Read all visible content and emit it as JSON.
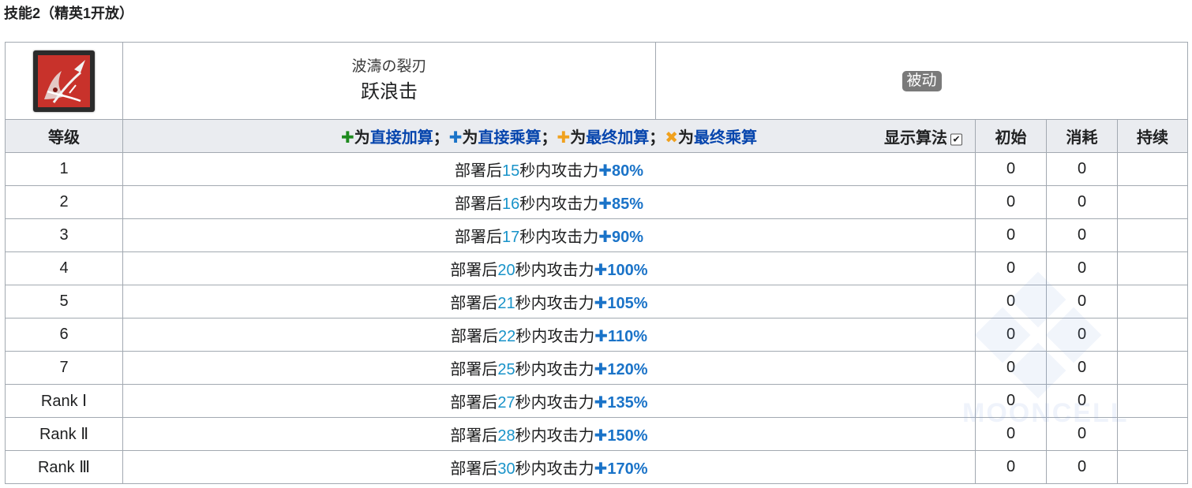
{
  "section": {
    "title": "技能2（精英1开放）"
  },
  "skill": {
    "name_jp": "波濤の裂刃",
    "name_cn": "跃浪击",
    "type_badge": "被动",
    "icon": "red-spear-skill-icon"
  },
  "header": {
    "level": "等级",
    "legend": {
      "sym1": "✚",
      "t1": "为",
      "l1": "直接加算",
      "sep1": "；",
      "sym2": "✚",
      "t2": "为",
      "l2": "直接乘算",
      "sep2": "；",
      "sym3": "✚",
      "t3": "为",
      "l3": "最终加算",
      "sep3": "；",
      "sym4": "✖",
      "t4": "为",
      "l4": "最终乘算"
    },
    "show_calc": "显示算法",
    "initial": "初始",
    "cost": "消耗",
    "duration": "持续"
  },
  "rows": [
    {
      "level": "1",
      "pre": "部署后",
      "sec": "15",
      "mid": "秒内攻击力",
      "plus": "✚",
      "pct": "80%",
      "initial": "0",
      "cost": "0",
      "duration": ""
    },
    {
      "level": "2",
      "pre": "部署后",
      "sec": "16",
      "mid": "秒内攻击力",
      "plus": "✚",
      "pct": "85%",
      "initial": "0",
      "cost": "0",
      "duration": ""
    },
    {
      "level": "3",
      "pre": "部署后",
      "sec": "17",
      "mid": "秒内攻击力",
      "plus": "✚",
      "pct": "90%",
      "initial": "0",
      "cost": "0",
      "duration": ""
    },
    {
      "level": "4",
      "pre": "部署后",
      "sec": "20",
      "mid": "秒内攻击力",
      "plus": "✚",
      "pct": "100%",
      "initial": "0",
      "cost": "0",
      "duration": ""
    },
    {
      "level": "5",
      "pre": "部署后",
      "sec": "21",
      "mid": "秒内攻击力",
      "plus": "✚",
      "pct": "105%",
      "initial": "0",
      "cost": "0",
      "duration": ""
    },
    {
      "level": "6",
      "pre": "部署后",
      "sec": "22",
      "mid": "秒内攻击力",
      "plus": "✚",
      "pct": "110%",
      "initial": "0",
      "cost": "0",
      "duration": ""
    },
    {
      "level": "7",
      "pre": "部署后",
      "sec": "25",
      "mid": "秒内攻击力",
      "plus": "✚",
      "pct": "120%",
      "initial": "0",
      "cost": "0",
      "duration": ""
    },
    {
      "level": "Rank Ⅰ",
      "pre": "部署后",
      "sec": "27",
      "mid": "秒内攻击力",
      "plus": "✚",
      "pct": "135%",
      "initial": "0",
      "cost": "0",
      "duration": ""
    },
    {
      "level": "Rank Ⅱ",
      "pre": "部署后",
      "sec": "28",
      "mid": "秒内攻击力",
      "plus": "✚",
      "pct": "150%",
      "initial": "0",
      "cost": "0",
      "duration": ""
    },
    {
      "level": "Rank Ⅲ",
      "pre": "部署后",
      "sec": "30",
      "mid": "秒内攻击力",
      "plus": "✚",
      "pct": "170%",
      "initial": "0",
      "cost": "0",
      "duration": ""
    }
  ],
  "watermark": {
    "text": "MOONCELL"
  },
  "colors": {
    "header_bg": "#eaecf0",
    "border": "#a2a9b1",
    "link": "#0645ad",
    "number": "#1993c9",
    "buff_blue": "#1a73c8",
    "green": "#1e8a1e",
    "orange": "#f0a11e",
    "badge_bg": "#7a7a7a"
  }
}
